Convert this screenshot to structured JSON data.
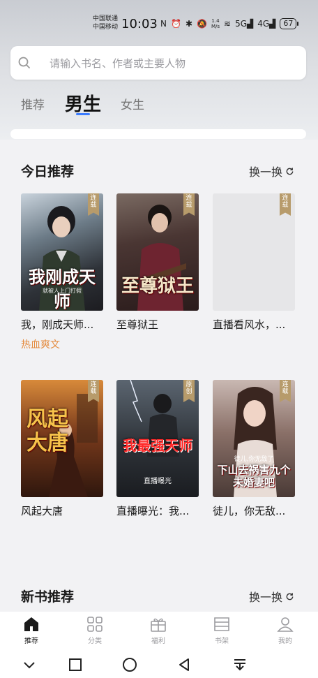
{
  "status": {
    "carrier1": "中国联通",
    "carrier2": "中国移动",
    "time": "10:03",
    "speed_value": "1.4",
    "speed_unit": "M/s",
    "net1": "5G",
    "net2": "4G",
    "battery": "67"
  },
  "search": {
    "placeholder": "请输入书名、作者或主要人物"
  },
  "tabs": [
    {
      "label": "推荐"
    },
    {
      "label": "男生",
      "selected": true
    },
    {
      "label": "女生"
    }
  ],
  "today": {
    "title": "今日推荐",
    "refresh_label": "换一换",
    "books": [
      {
        "title": "我，刚成天师...",
        "badge": "连载",
        "tag": "热血爽文",
        "cover_text": "我刚成天师",
        "cover_sub": "就被人上门打假"
      },
      {
        "title": "至尊狱王",
        "badge": "连载",
        "cover_text": "至尊狱王"
      },
      {
        "title": "直播看风水，...",
        "badge": "连载"
      },
      {
        "title": "风起大唐",
        "badge": "连载",
        "cover_text": "风起大唐"
      },
      {
        "title": "直播曝光：我...",
        "badge": "原创",
        "cover_text": "我最强天师",
        "cover_sub": "直播曝光"
      },
      {
        "title": "徒儿，你无敌...",
        "badge": "连载",
        "cover_text": "下山去祸害九个未婚妻吧",
        "cover_sub": "徒儿,你无敌了"
      }
    ]
  },
  "new_books": {
    "title": "新书推荐",
    "refresh_label": "换一换"
  },
  "nav": [
    {
      "label": "推荐",
      "icon": "home-icon",
      "active": true
    },
    {
      "label": "分类",
      "icon": "category-icon"
    },
    {
      "label": "福利",
      "icon": "gift-icon"
    },
    {
      "label": "书架",
      "icon": "bookshelf-icon"
    },
    {
      "label": "我的",
      "icon": "profile-icon"
    }
  ],
  "colors": {
    "accent": "#3b7cff",
    "tag": "#e48a3c",
    "ribbon": "#b79b6b"
  }
}
